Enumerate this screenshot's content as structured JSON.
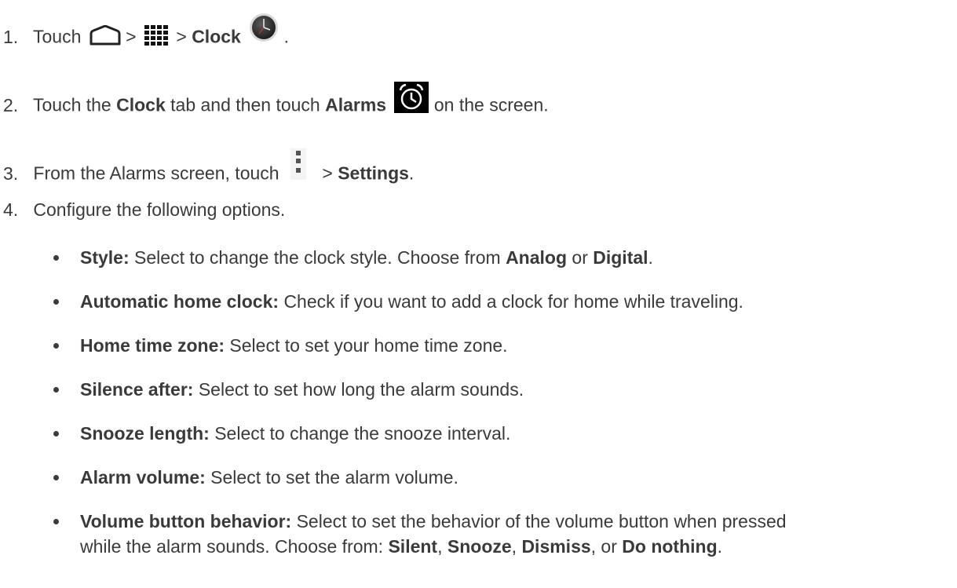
{
  "steps": [
    {
      "number": "1.",
      "t1": "Touch",
      "sep1": ">",
      "sep2": ">",
      "bold1": "Clock",
      "end": ".",
      "icons": [
        "home-outline-icon",
        "apps-grid-icon",
        "clock-app-icon"
      ]
    },
    {
      "number": "2.",
      "t1": "Touch the",
      "bold1": "Clock",
      "t2": "tab and then touch",
      "bold2": "Alarms",
      "t3": "on the screen.",
      "icons": [
        "alarm-clock-icon"
      ]
    },
    {
      "number": "3.",
      "t1": "From the Alarms screen, touch",
      "sep1": ">",
      "bold1": "Settings",
      "end": ".",
      "icons": [
        "overflow-menu-icon"
      ]
    },
    {
      "number": "4.",
      "t1": "Configure the following options."
    }
  ],
  "options": [
    {
      "label": "Style:",
      "t1": "Select to change the clock style. Choose from",
      "b1": "Analog",
      "t2": "or",
      "b2": "Digital",
      "end": "."
    },
    {
      "label": "Automatic home clock:",
      "t1": "Check if you want to add a clock for home while traveling."
    },
    {
      "label": "Home time zone:",
      "t1": "Select to set your home time zone."
    },
    {
      "label": "Silence after:",
      "t1": "Select to set how long the alarm sounds."
    },
    {
      "label": "Snooze length:",
      "t1": "Select to change the snooze interval."
    },
    {
      "label": "Alarm volume:",
      "t1": "Select to set the alarm volume."
    },
    {
      "label": "Volume button behavior:",
      "t1": "Select to set the behavior of the volume button when pressed",
      "t2": "while the alarm sounds. Choose from:",
      "b1": "Silent",
      "c1": ",",
      "b2": "Snooze",
      "c2": ",",
      "b3": "Dismiss",
      "c3": ", or",
      "b4": "Do nothing",
      "end": "."
    }
  ]
}
